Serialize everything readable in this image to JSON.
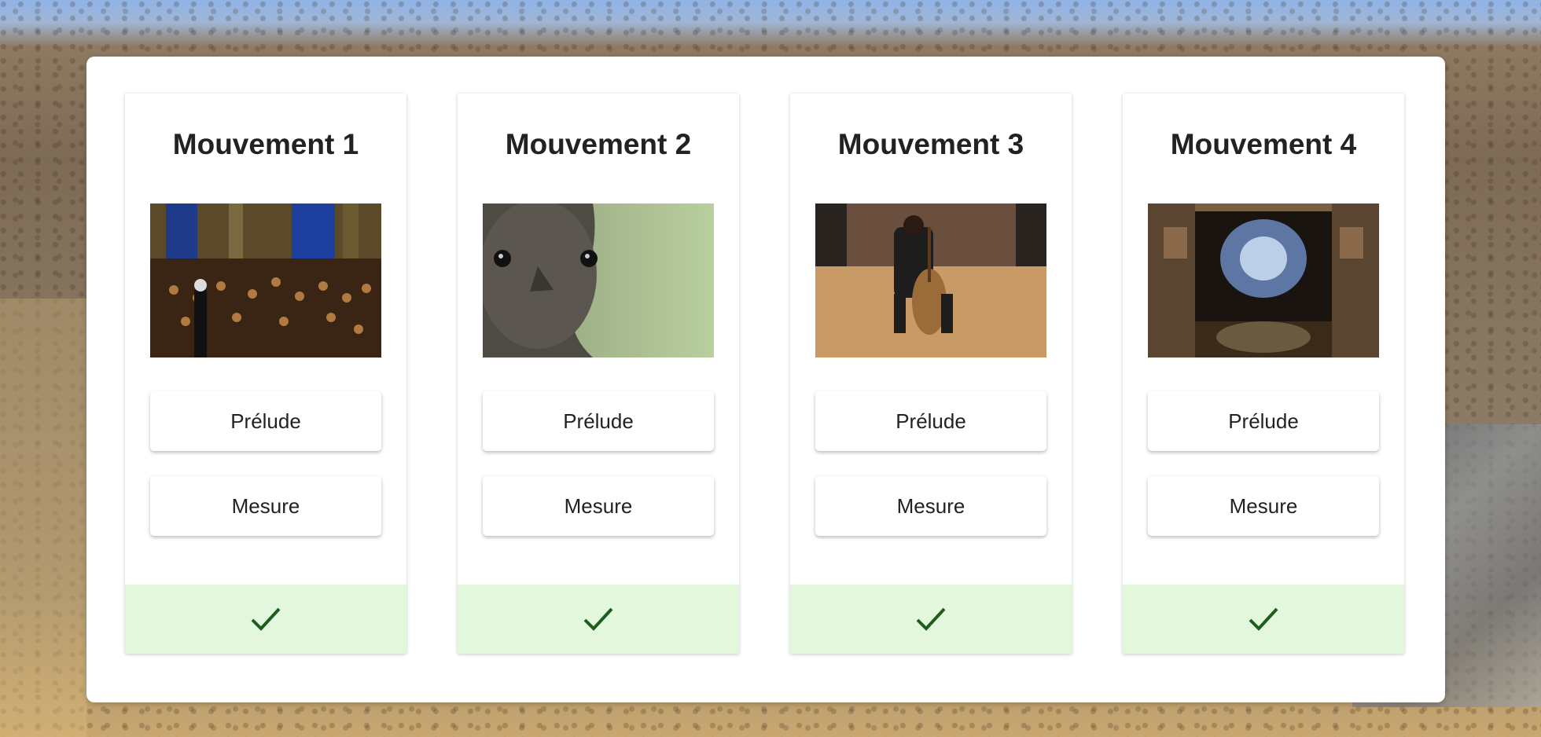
{
  "movements": [
    {
      "title": "Mouvement 1",
      "image": "orchestra-concert-photo",
      "options": [
        "Prélude",
        "Mesure"
      ],
      "status_icon": "check-icon"
    },
    {
      "title": "Mouvement 2",
      "image": "bird-closeup-photo",
      "options": [
        "Prélude",
        "Mesure"
      ],
      "status_icon": "check-icon"
    },
    {
      "title": "Mouvement 3",
      "image": "cellist-photo",
      "options": [
        "Prélude",
        "Mesure"
      ],
      "status_icon": "check-icon"
    },
    {
      "title": "Mouvement 4",
      "image": "ornate-ceiling-photo",
      "options": [
        "Prélude",
        "Mesure"
      ],
      "status_icon": "check-icon"
    }
  ],
  "colors": {
    "success_bg": "#e3f7dc",
    "check": "#1b5e20",
    "title": "#222222"
  }
}
